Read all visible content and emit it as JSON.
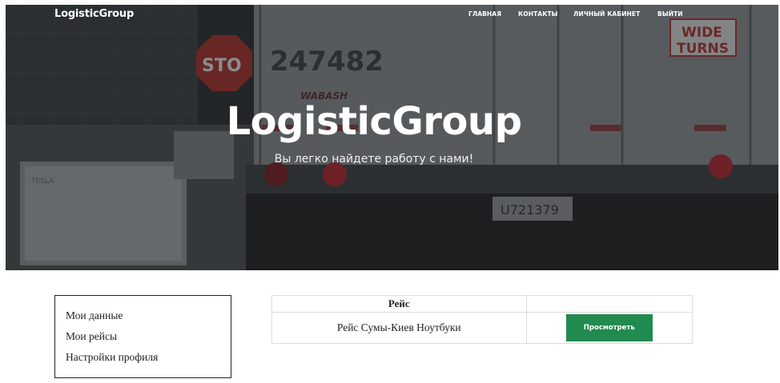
{
  "brand": "LogisticGroup",
  "nav": [
    {
      "label": "главная"
    },
    {
      "label": "контакты"
    },
    {
      "label": "личный кабинет"
    },
    {
      "label": "выйти"
    }
  ],
  "hero": {
    "title": "LogisticGroup",
    "subtitle": "Вы легко найдете работу с нами!",
    "image": {
      "truck_number": "247482",
      "plate": "U721379",
      "sign_stop": "STO",
      "sign_wide": "WIDE",
      "sign_turns": "TURNS",
      "logo_text": "WABASH",
      "tesla_text": "TESLA"
    }
  },
  "sidebar": {
    "items": [
      {
        "label": "Мои данные"
      },
      {
        "label": "Мои рейсы"
      },
      {
        "label": "Настройки профиля"
      }
    ]
  },
  "table": {
    "headers": [
      "Рейс",
      ""
    ],
    "rows": [
      {
        "trip": "Рейс Сумы-Киев Ноутбуки",
        "action_label": "Просмотреть"
      }
    ]
  },
  "colors": {
    "accent": "#218a4e",
    "hero_overlay": "#2d3133"
  }
}
